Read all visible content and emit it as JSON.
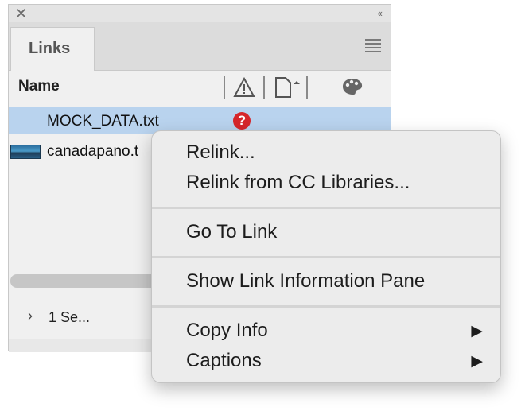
{
  "panel": {
    "tab_label": "Links",
    "column_header_name": "Name",
    "rows": [
      {
        "label": "MOCK_DATA.txt",
        "status": "missing"
      },
      {
        "label": "canadapano.t",
        "status": "ok"
      }
    ],
    "footer_text": "1 Se..."
  },
  "context_menu": {
    "items": [
      {
        "label": "Relink...",
        "submenu": false
      },
      {
        "label": "Relink from CC Libraries...",
        "submenu": false
      },
      {
        "label": "Go To Link",
        "submenu": false
      },
      {
        "label": "Show Link Information Pane",
        "submenu": false
      },
      {
        "label": "Copy Info",
        "submenu": true
      },
      {
        "label": "Captions",
        "submenu": true
      }
    ]
  },
  "colors": {
    "selected_row": "#b9d3ee",
    "missing_icon": "#d6262b",
    "menu_background": "#ececec"
  },
  "icons": {
    "close": "close-icon",
    "collapse": "double-chevron-left-icon",
    "panel_menu": "hamburger-icon",
    "status_column": "warning-triangle-icon",
    "page_column": "page-icon",
    "color_column": "palette-icon",
    "missing": "question-mark-icon",
    "submenu": "triangle-right-icon"
  }
}
